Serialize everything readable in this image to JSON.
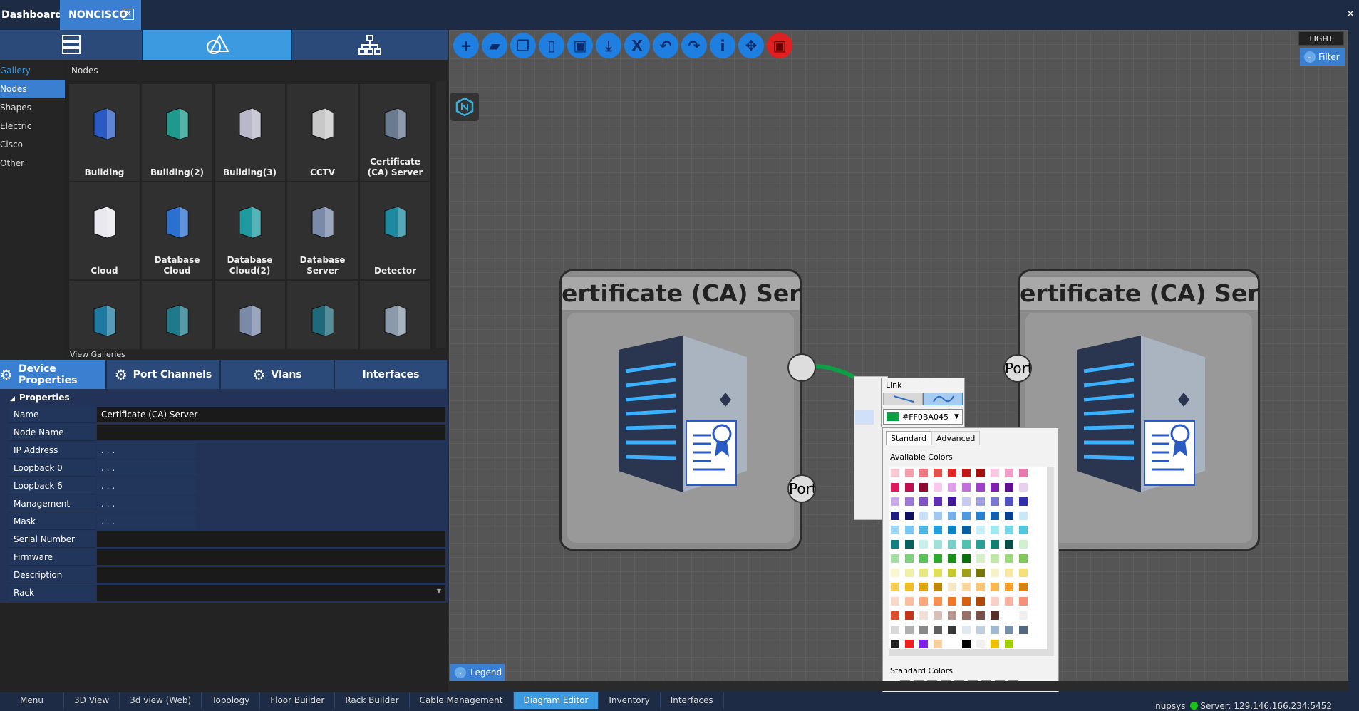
{
  "tabs": {
    "dashboard": "Dashboard",
    "noncisco": "NONCISCO",
    "close": "✕"
  },
  "window_close": "✕",
  "gallery": {
    "nav": [
      "Gallery",
      "Nodes",
      "Shapes",
      "Electric",
      "Cisco",
      "Other"
    ],
    "header": "Nodes",
    "view_galleries": "View Galleries",
    "items": [
      {
        "label": "Building",
        "icon": "building-icon",
        "color": "#2a5bc4"
      },
      {
        "label": "Building(2)",
        "icon": "building-2-icon",
        "color": "#1e9a8c"
      },
      {
        "label": "Building(3)",
        "icon": "building-3-icon",
        "color": "#b8b8c8"
      },
      {
        "label": "CCTV",
        "icon": "cctv-icon",
        "color": "#c8c8c8"
      },
      {
        "label": "Certificate (CA) Server",
        "icon": "certificate-server-icon",
        "color": "#6a7a90"
      },
      {
        "label": "Cloud",
        "icon": "cloud-icon",
        "color": "#e8e8ee"
      },
      {
        "label": "Database Cloud",
        "icon": "database-cloud-icon",
        "color": "#2a70d0"
      },
      {
        "label": "Database Cloud(2)",
        "icon": "database-cloud-2-icon",
        "color": "#1e9aa0"
      },
      {
        "label": "Database Server",
        "icon": "database-server-icon",
        "color": "#7a8aa8"
      },
      {
        "label": "Detector",
        "icon": "detector-icon",
        "color": "#1e8aa0"
      },
      {
        "label": "",
        "icon": "network-node-icon",
        "color": "#1e7aa0"
      },
      {
        "label": "",
        "icon": "router-icon",
        "color": "#1e7a8a"
      },
      {
        "label": "",
        "icon": "mail-server-icon",
        "color": "#7a8aa8"
      },
      {
        "label": "",
        "icon": "device-icon",
        "color": "#1e6a7a"
      },
      {
        "label": "",
        "icon": "server-icon",
        "color": "#8a9aaa"
      }
    ]
  },
  "property_tabs": [
    "Device Properties",
    "Port Channels",
    "Vlans",
    "Interfaces"
  ],
  "properties": {
    "header": "Properties",
    "rows": [
      {
        "key": "Name",
        "value": "Certificate (CA) Server",
        "type": "text"
      },
      {
        "key": "Node Name",
        "value": "",
        "type": "text"
      },
      {
        "key": "IP Address",
        "value": ".     .     .",
        "type": "ip"
      },
      {
        "key": "Loopback 0",
        "value": ".     .     .",
        "type": "ip"
      },
      {
        "key": "Loopback 6",
        "value": ".     .     .",
        "type": "ip"
      },
      {
        "key": "Management",
        "value": ".     .     .",
        "type": "ip"
      },
      {
        "key": "Mask",
        "value": ".     .     .",
        "type": "ip"
      },
      {
        "key": "Serial Number",
        "value": "",
        "type": "text"
      },
      {
        "key": "Firmware",
        "value": "",
        "type": "text"
      },
      {
        "key": "Description",
        "value": "",
        "type": "text"
      },
      {
        "key": "Rack",
        "value": "",
        "type": "select"
      }
    ]
  },
  "toolbar": {
    "buttons": [
      "add-icon",
      "layers-icon",
      "copy-icon",
      "new-page-icon",
      "save-icon",
      "download-icon",
      "excel-icon",
      "undo-icon",
      "redo-icon",
      "info-icon",
      "move-icon",
      "save-red-icon"
    ]
  },
  "theme": {
    "light": "LIGHT",
    "filter": "Filter"
  },
  "diagram": {
    "node_left": {
      "title": "Certificate (CA) Server",
      "title_visible": "ertificate (CA) Serve"
    },
    "node_right": {
      "title": "Certificate (CA) Server",
      "title_visible": "ertificate (CA) Serve"
    },
    "port_label": "Port",
    "link_color": "#0BA045"
  },
  "link_editor": {
    "title": "Link",
    "color_value": "#FF0BA045"
  },
  "color_picker": {
    "tabs": [
      "Standard",
      "Advanced"
    ],
    "available_label": "Available Colors",
    "standard_label": "Standard Colors",
    "standard_colors": [
      "#ffffff",
      "#808080",
      "#000000",
      "#ff0000",
      "#008000",
      "#0000ff",
      "#ffff00",
      "#ffa500",
      "#800080"
    ],
    "available_rows": [
      [
        "#f8c8d0",
        "#f4a0a8",
        "#f07880",
        "#e85050",
        "#e02828",
        "#c01818",
        "#a01010",
        "#f8c8e0",
        "#f0a0c8",
        "#e878b0"
      ],
      [
        "#e01860",
        "#c01050",
        "#900830",
        "#f8c8f0",
        "#e0a0e8",
        "#c070d8",
        "#a040c8",
        "#8020b0",
        "#601090",
        "#e8d0f0"
      ],
      [
        "#c8a8e8",
        "#a078d8",
        "#8050c8",
        "#6030b0",
        "#401898",
        "#c8c8f0",
        "#a0a0e0",
        "#7878d0",
        "#5050c0",
        "#3030a8"
      ],
      [
        "#202080",
        "#101060",
        "#c8e0f8",
        "#a0c8f0",
        "#78b0e8",
        "#5098e0",
        "#2880d0",
        "#1060b0",
        "#084090",
        "#c8e8f8"
      ],
      [
        "#a0d8f8",
        "#78c8f0",
        "#50b8e8",
        "#28a0e0",
        "#1080c8",
        "#0860a0",
        "#c8f0f8",
        "#a0e8f0",
        "#78d8e8",
        "#50c8e0"
      ],
      [
        "#108080",
        "#086060",
        "#c8f0e8",
        "#a0e0d8",
        "#78d0c8",
        "#50c0b0",
        "#28a098",
        "#108070",
        "#085048",
        "#d0f0d0"
      ],
      [
        "#a8e0a8",
        "#80d080",
        "#58c058",
        "#30a830",
        "#189018",
        "#087008",
        "#d8f0c8",
        "#c0e8a8",
        "#a0d880",
        "#80c858"
      ],
      [
        "#f8f8d0",
        "#f0f0a8",
        "#e8e880",
        "#e0e058",
        "#c8c830",
        "#a0a018",
        "#787808",
        "#f8f0c8",
        "#f8e8a0",
        "#f8e078"
      ],
      [
        "#f8d050",
        "#f0c028",
        "#e0a810",
        "#c08808",
        "#f8e8c8",
        "#f8d8a0",
        "#f8c878",
        "#f8b850",
        "#f8a028",
        "#e08010"
      ],
      [
        "#f8d8c8",
        "#f8c0a0",
        "#f8a878",
        "#f89050",
        "#f07828",
        "#d86010",
        "#b04808",
        "#f8d0c8",
        "#f8b0a0",
        "#f89078"
      ],
      [
        "#e05030",
        "#c03818",
        "#f0e0d8",
        "#d8c0b8",
        "#b89890",
        "#987068",
        "#785048",
        "#583028",
        "#ffffff",
        "#f0f0f0"
      ],
      [
        "#d8d8d8",
        "#b0b0b0",
        "#888888",
        "#606060",
        "#383838",
        "#e0e8f0",
        "#c0d0e0",
        "#a0b8d0",
        "#7890a8",
        "#506880"
      ],
      [
        "#202020",
        "#f02020",
        "#8020f0",
        "#f8d0a0",
        "#ffffff",
        "#000000",
        "#f0f0f0",
        "#f0c000",
        "#a0d000",
        "#ffffff"
      ]
    ]
  },
  "legend": "Legend",
  "bottom_tabs": [
    "Menu",
    "3D View",
    "3d view (Web)",
    "Topology",
    "Floor Builder",
    "Rack Builder",
    "Cable Management",
    "Diagram Editor",
    "Inventory",
    "Interfaces"
  ],
  "status": {
    "user": "nupsys",
    "server": "Server: 129.146.166.234:5452",
    "server_color": "#1cc01c"
  }
}
